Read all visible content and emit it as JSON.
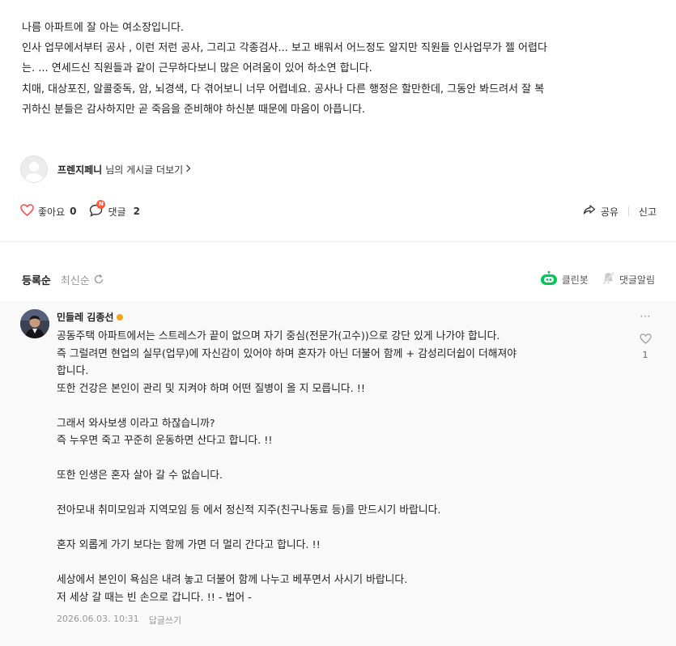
{
  "post": {
    "lines": [
      "나름  아파트에 잘 아는 여소장입니다.",
      "인사 업무에서부터 공사 ,  이런 저런  공사,  그리고  각종검사...   보고 배워서 어느정도 알지만  직원들  인사업무가  젤  어렵다",
      "는. ...    연세드신  직원들과  같이  근무하다보니   많은  어려움이  있어  하소연  합니다.",
      "치매,  대상포진,  알콜중독, 암,  뇌경색,  다  겪어보니   너무 어렵네요.   공사나    다른   행정은   할만한데,  그동안  봐드려서  잘  복",
      "귀하신 분들은   감사하지만  곧  죽음을  준비해야 하신분  때문에 마음이   아픕니다."
    ]
  },
  "author": {
    "name": "프렌지페니",
    "suffix": "님의 게시글 더보기"
  },
  "actions": {
    "like_label": "좋아요",
    "like_count": "0",
    "comment_label": "댓글",
    "comment_count": "2",
    "new_badge": "N",
    "share_label": "공유",
    "report_label": "신고"
  },
  "comments_header": {
    "sort_registered": "등록순",
    "sort_latest": "최신순",
    "cleanbot_label": "클린봇",
    "notify_label": "댓글알림"
  },
  "comment": {
    "author": "민들레 김종선",
    "lines": [
      "공동주택 아파트에서는 스트레스가 끝이 없으며 자기 중심(전문가(고수))으로 강단 있게 나가야 합니다.",
      "즉 그럴려면 현업의 실무(업무)에 자신감이 있어야 하며 혼자가 아닌 더불어 함께 + 감성리더쉽이 더해져야",
      "합니다.",
      "또한 건강은 본인이 관리 및 지켜야 하며 어떤 질병이 올 지 모릅니다. !!",
      "",
      "그래서 와사보생 이라고 하잖습니까?",
      "즉 누우면 죽고 꾸준히 운동하면 산다고 합니다. !!",
      "",
      "또한 인생은 혼자 살아 갈 수 없습니다.",
      "",
      "전아모내 취미모임과 지역모임 등 에서 정신적 지주(친구나동료 등)를 만드시기 바랍니다.",
      "",
      "혼자 외롭게 가기 보다는 함께 가면 더 멀리 간다고 합니다. !!",
      "",
      "세상에서 본인이 욕심은 내려 놓고 더불어 함께 나누고 베푸면서 사시기 바랍니다.",
      "저 세상 갈 때는 빈 손으로 갑니다. !! - 법어 -"
    ],
    "like_count": "1",
    "date": "2026.06.03. 10:31",
    "reply_label": "답글쓰기"
  },
  "colors": {
    "heart": "#ff4a4a",
    "cleanbot": "#03c75a",
    "badge": "#ff5a3c",
    "gold_badge": "#f7a21b"
  }
}
